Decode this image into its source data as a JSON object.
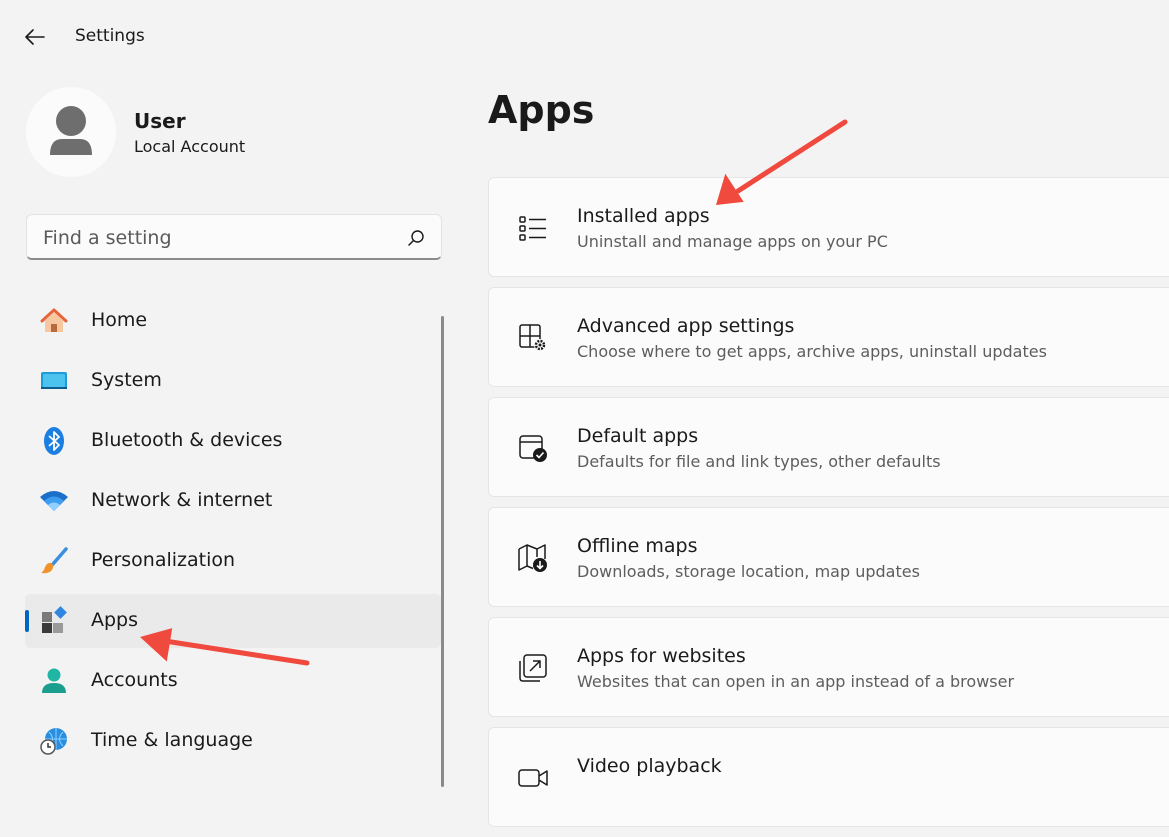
{
  "window": {
    "title": "Settings"
  },
  "profile": {
    "name": "User",
    "account_type": "Local Account"
  },
  "search": {
    "placeholder": "Find a setting"
  },
  "sidebar": {
    "items": [
      {
        "label": "Home",
        "icon": "home-icon"
      },
      {
        "label": "System",
        "icon": "system-icon"
      },
      {
        "label": "Bluetooth & devices",
        "icon": "bluetooth-icon"
      },
      {
        "label": "Network & internet",
        "icon": "wifi-icon"
      },
      {
        "label": "Personalization",
        "icon": "brush-icon"
      },
      {
        "label": "Apps",
        "icon": "apps-icon",
        "selected": true
      },
      {
        "label": "Accounts",
        "icon": "accounts-icon"
      },
      {
        "label": "Time & language",
        "icon": "time-language-icon"
      }
    ]
  },
  "main": {
    "title": "Apps",
    "cards": [
      {
        "title": "Installed apps",
        "subtitle": "Uninstall and manage apps on your PC",
        "icon": "list-icon"
      },
      {
        "title": "Advanced app settings",
        "subtitle": "Choose where to get apps, archive apps, uninstall updates",
        "icon": "app-settings-icon"
      },
      {
        "title": "Default apps",
        "subtitle": "Defaults for file and link types, other defaults",
        "icon": "default-apps-icon"
      },
      {
        "title": "Offline maps",
        "subtitle": "Downloads, storage location, map updates",
        "icon": "map-download-icon"
      },
      {
        "title": "Apps for websites",
        "subtitle": "Websites that can open in an app instead of a browser",
        "icon": "open-external-icon"
      },
      {
        "title": "Video playback",
        "subtitle": "",
        "icon": "video-camera-icon"
      }
    ]
  },
  "annotations": {
    "color": "#f04a3e"
  },
  "colors": {
    "accent": "#0067c0",
    "background": "#f3f3f3",
    "card": "#fbfbfb"
  }
}
